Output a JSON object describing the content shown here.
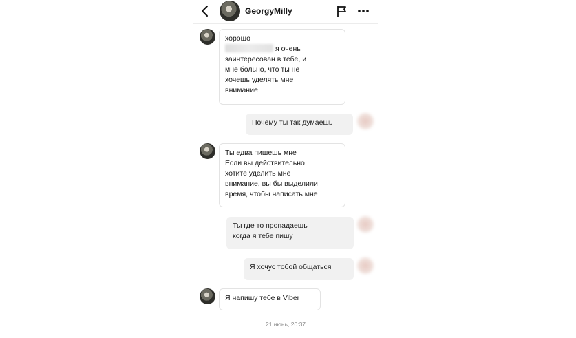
{
  "header": {
    "username": "GeorgyMilly"
  },
  "messages": [
    {
      "direction": "in",
      "text_line1": "хорошо",
      "text_rest": "я очень\nзаинтересован в тебе, и\nмне больно, что ты не\nхочешь уделять мне\nвнимание"
    },
    {
      "direction": "out",
      "text": "Почему ты так думаешь"
    },
    {
      "direction": "in",
      "text": "Ты едва пишешь мне\nЕсли вы действительно\nхотите уделить мне\nвнимание, вы бы выделили\nвремя, чтобы написать мне"
    },
    {
      "direction": "out",
      "text": "Ты где то пропадаешь\nкогда я тебе пишу"
    },
    {
      "direction": "out",
      "text": "Я хочус тобой общаться"
    },
    {
      "direction": "in",
      "text": "Я напишу тебе в Viber"
    }
  ],
  "timestamp": "21 июнь, 20:37",
  "icons": {
    "back": "chevron-left-icon",
    "flag": "flag-icon",
    "more": "more-horizontal-icon"
  }
}
